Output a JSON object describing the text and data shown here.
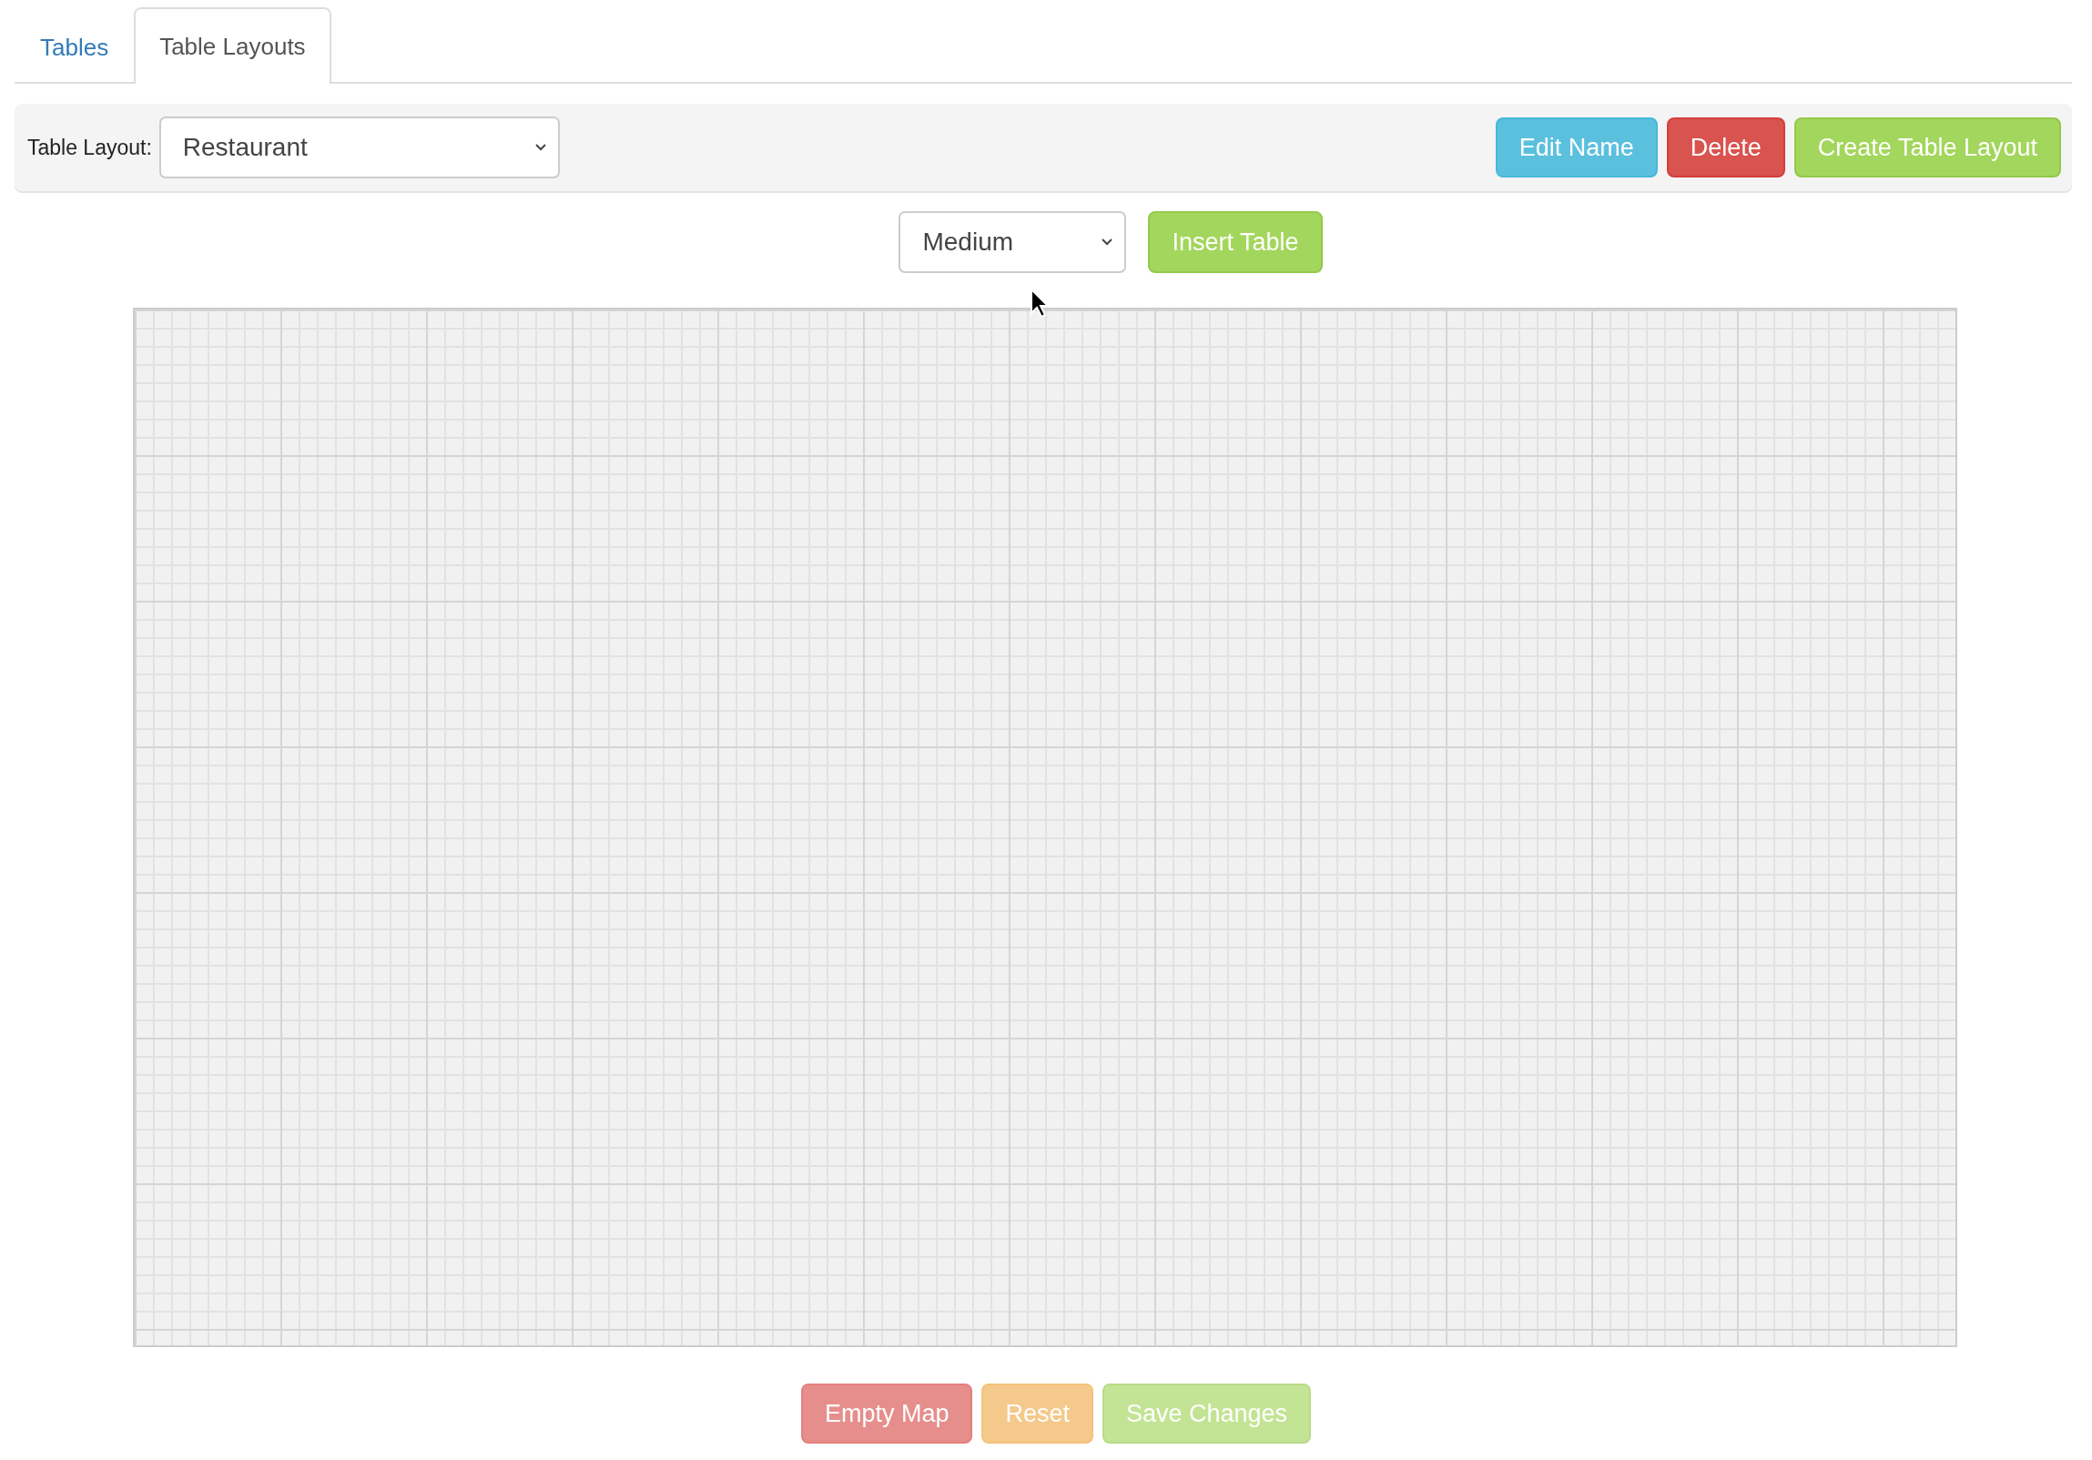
{
  "tabs": [
    {
      "label": "Tables",
      "selected": false
    },
    {
      "label": "Table Layouts",
      "selected": true
    }
  ],
  "toolbar": {
    "label": "Table Layout:",
    "layout_select": {
      "value": "Restaurant"
    },
    "buttons": [
      {
        "label": "Edit Name",
        "kind": "info",
        "disabled": false
      },
      {
        "label": "Delete",
        "kind": "danger",
        "disabled": false
      },
      {
        "label": "Create Table Layout",
        "kind": "success",
        "disabled": false
      }
    ]
  },
  "insert": {
    "size_select": {
      "value": "Medium"
    },
    "button": {
      "label": "Insert Table",
      "kind": "success",
      "disabled": false
    }
  },
  "footer_buttons": [
    {
      "label": "Empty Map",
      "kind": "danger",
      "disabled": true
    },
    {
      "label": "Reset",
      "kind": "warning",
      "disabled": true
    },
    {
      "label": "Save Changes",
      "kind": "success",
      "disabled": true
    }
  ]
}
